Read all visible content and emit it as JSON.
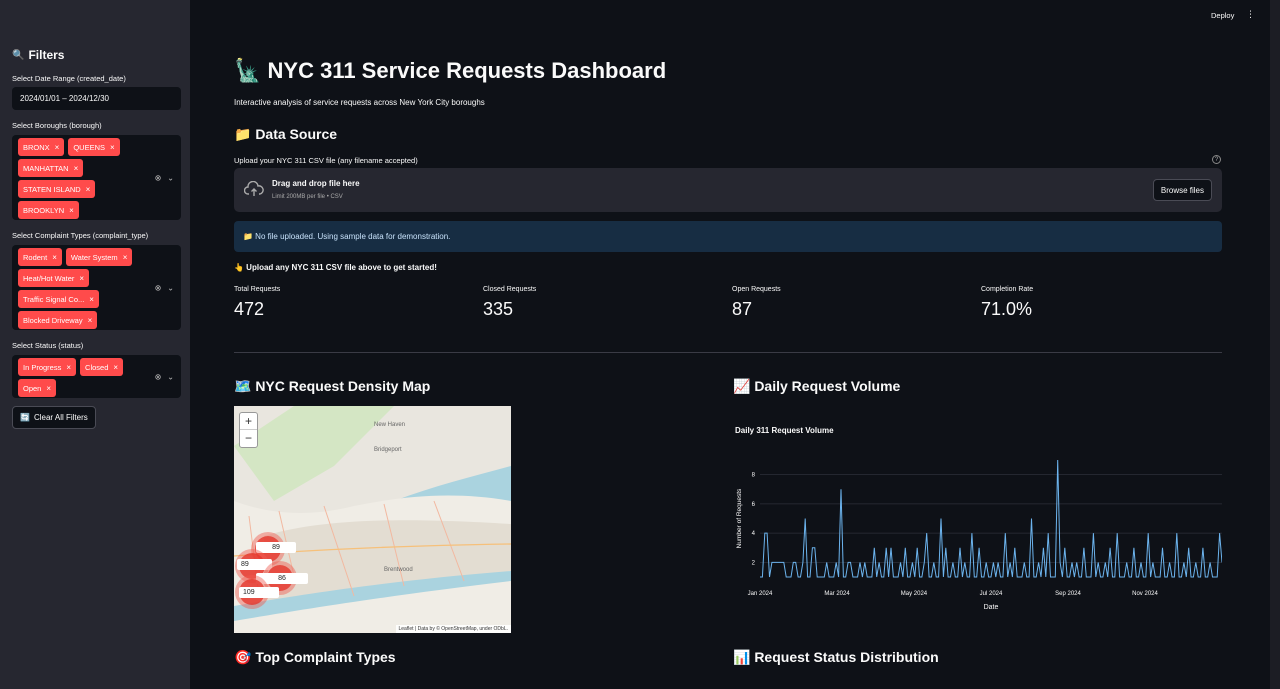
{
  "topbar": {
    "deploy": "Deploy",
    "menu": "⋮"
  },
  "sidebar": {
    "title": "Filters",
    "title_icon": "🔍",
    "date_label": "Select Date Range (created_date)",
    "date_value": "2024/01/01 – 2024/12/30",
    "boroughs_label": "Select Boroughs (borough)",
    "boroughs": [
      "BRONX",
      "QUEENS",
      "MANHATTAN",
      "STATEN ISLAND",
      "BROOKLYN"
    ],
    "complaint_label": "Select Complaint Types (complaint_type)",
    "complaints": [
      "Rodent",
      "Water System",
      "Heat/Hot Water",
      "Traffic Signal Co...",
      "Blocked Driveway"
    ],
    "status_label": "Select Status (status)",
    "statuses": [
      "In Progress",
      "Closed",
      "Open"
    ],
    "clear_label": "Clear All Filters",
    "clear_icon": "🔄"
  },
  "main": {
    "title": "🗽 NYC 311 Service Requests Dashboard",
    "subtitle": "Interactive analysis of service requests across New York City boroughs",
    "data_source_heading": "📁 Data Source",
    "upload_label": "Upload your NYC 311 CSV file (any filename accepted)",
    "help_icon": "?",
    "dropzone_main": "Drag and drop file here",
    "dropzone_sub": "Limit 200MB per file • CSV",
    "browse_label": "Browse files",
    "info_text": "📁 No file uploaded. Using sample data for demonstration.",
    "prompt_text": "👆 Upload any NYC 311 CSV file above to get started!",
    "metrics": [
      {
        "label": "Total Requests",
        "value": "472"
      },
      {
        "label": "Closed Requests",
        "value": "335"
      },
      {
        "label": "Open Requests",
        "value": "87"
      },
      {
        "label": "Completion Rate",
        "value": "71.0%"
      }
    ],
    "map_heading": "🗺️ NYC Request Density Map",
    "volume_heading": "📈 Daily Request Volume",
    "complaint_heading": "🎯 Top Complaint Types",
    "status_heading": "📊 Request Status Distribution"
  },
  "map": {
    "zoom_in": "+",
    "zoom_out": "−",
    "clusters": [
      "89",
      "89",
      "86",
      "109"
    ],
    "attribution": "Leaflet | Data by © OpenStreetMap, under ODbL."
  },
  "chart_data": {
    "type": "line",
    "title": "Daily 311 Request Volume",
    "xlabel": "Date",
    "ylabel": "Number of Requests",
    "x_ticks": [
      "Jan 2024",
      "Mar 2024",
      "May 2024",
      "Jul 2024",
      "Sep 2024",
      "Nov 2024"
    ],
    "y_ticks": [
      2,
      4,
      6,
      8
    ],
    "ylim": [
      1,
      9
    ],
    "color": "#6cb4ee",
    "series": [
      {
        "values": [
          1,
          1,
          4,
          4,
          1,
          2,
          2,
          2,
          2,
          2,
          2,
          1,
          1,
          1,
          2,
          2,
          1,
          1,
          2,
          5,
          1,
          1,
          3,
          3,
          1,
          1,
          1,
          1,
          2,
          1,
          1,
          1,
          2,
          1,
          7,
          1,
          1,
          2,
          2,
          1,
          1,
          1,
          2,
          1,
          2,
          1,
          1,
          1,
          3,
          1,
          2,
          1,
          1,
          3,
          1,
          3,
          1,
          1,
          1,
          2,
          1,
          3,
          1,
          1,
          2,
          1,
          3,
          1,
          1,
          2,
          4,
          1,
          1,
          2,
          1,
          1,
          5,
          1,
          3,
          1,
          1,
          2,
          1,
          1,
          3,
          1,
          2,
          1,
          1,
          4,
          1,
          1,
          3,
          1,
          1,
          2,
          1,
          1,
          2,
          1,
          2,
          1,
          1,
          4,
          1,
          2,
          1,
          3,
          1,
          1,
          1,
          2,
          1,
          1,
          5,
          1,
          1,
          2,
          1,
          3,
          1,
          4,
          1,
          1,
          1,
          9,
          2,
          1,
          3,
          1,
          1,
          2,
          1,
          2,
          1,
          1,
          3,
          1,
          1,
          1,
          4,
          1,
          2,
          1,
          1,
          2,
          1,
          3,
          1,
          1,
          4,
          1,
          1,
          1,
          2,
          1,
          1,
          3,
          1,
          1,
          2,
          1,
          1,
          4,
          1,
          2,
          1,
          1,
          1,
          3,
          1,
          1,
          2,
          1,
          1,
          4,
          1,
          1,
          2,
          1,
          3,
          1,
          1,
          2,
          1,
          1,
          3,
          1,
          1,
          2,
          1,
          1,
          1,
          4,
          2
        ]
      }
    ]
  }
}
